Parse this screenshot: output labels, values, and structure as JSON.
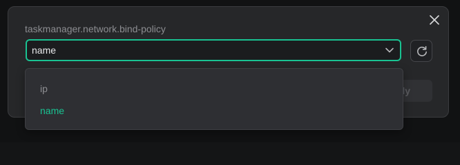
{
  "dialog": {
    "field_label": "taskmanager.network.bind-policy",
    "close_icon": "close-icon",
    "select": {
      "value": "name",
      "chevron_icon": "chevron-down-icon"
    },
    "reset_icon": "reset-icon",
    "apply_label": "Apply",
    "dropdown": {
      "options": [
        {
          "label": "ip",
          "selected": false
        },
        {
          "label": "name",
          "selected": true
        }
      ]
    }
  },
  "colors": {
    "accent": "#19c392",
    "dialog_bg": "#262729",
    "dropdown_bg": "#2e2f33",
    "page_bg": "#111213"
  }
}
